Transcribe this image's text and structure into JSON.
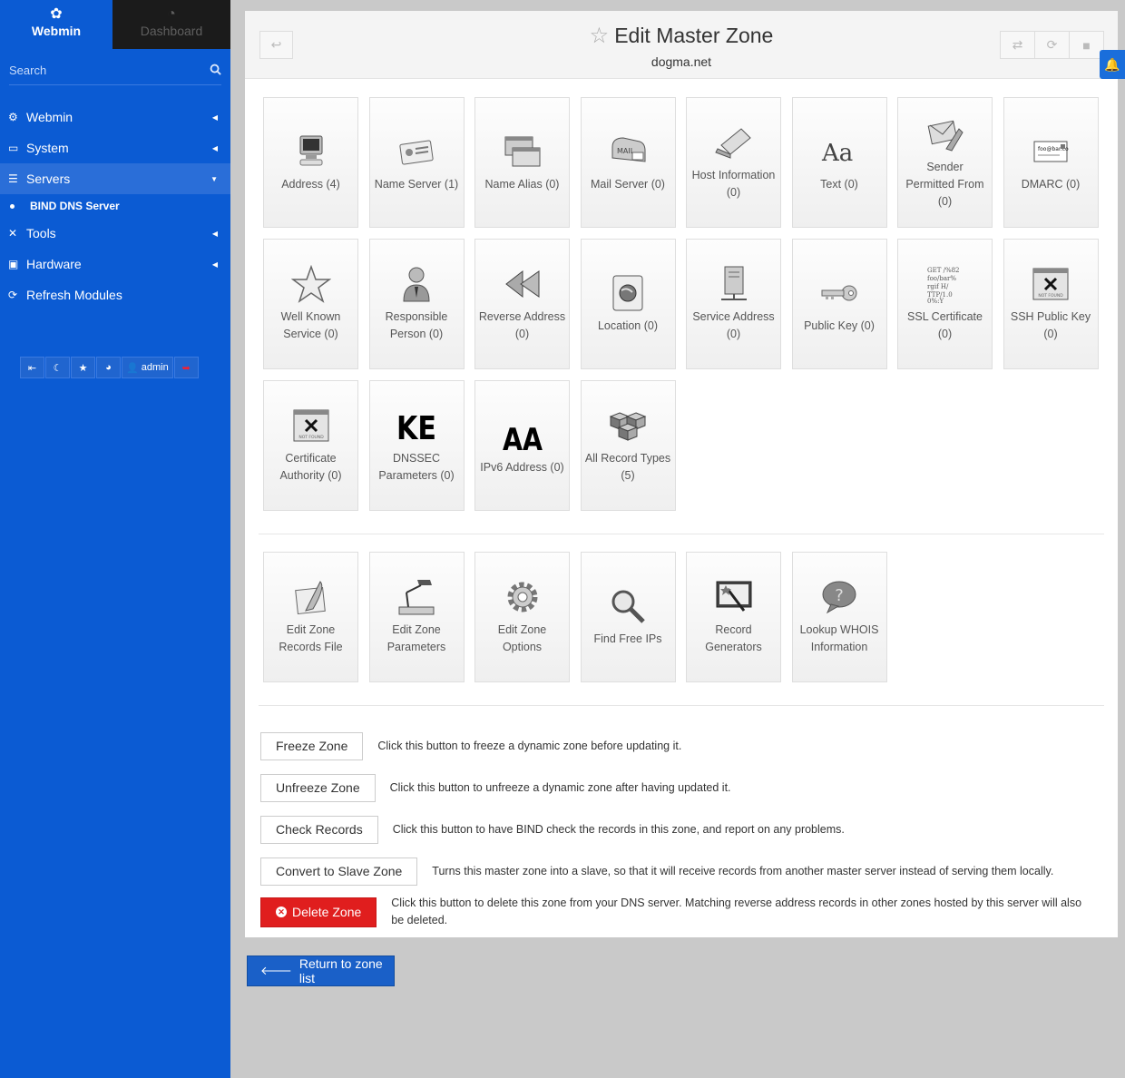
{
  "sidebar": {
    "tabs": {
      "webmin": "Webmin",
      "dashboard": "Dashboard"
    },
    "search_placeholder": "Search",
    "menu": {
      "webmin": "Webmin",
      "system": "System",
      "servers": "Servers",
      "bind": "BIND DNS Server",
      "tools": "Tools",
      "hardware": "Hardware",
      "refresh": "Refresh Modules"
    },
    "user": "admin"
  },
  "header": {
    "title": "Edit Master Zone",
    "zone": "dogma.net"
  },
  "record_tiles": [
    {
      "label": "Address (4)",
      "icon": "computer-icon"
    },
    {
      "label": "Name Server (1)",
      "icon": "id-card-icon"
    },
    {
      "label": "Name Alias (0)",
      "icon": "windows-icon"
    },
    {
      "label": "Mail Server (0)",
      "icon": "mailbox-icon"
    },
    {
      "label": "Host Information (0)",
      "icon": "laptop-icon"
    },
    {
      "label": "Text (0)",
      "icon": "font-icon"
    },
    {
      "label": "Sender Permitted From (0)",
      "icon": "mail-wrench-icon"
    },
    {
      "label": "DMARC (0)",
      "icon": "email-card-icon"
    },
    {
      "label": "Well Known Service (0)",
      "icon": "star-icon"
    },
    {
      "label": "Responsible Person (0)",
      "icon": "person-icon"
    },
    {
      "label": "Reverse Address (0)",
      "icon": "rewind-icon"
    },
    {
      "label": "Location (0)",
      "icon": "globe-icon"
    },
    {
      "label": "Service Address (0)",
      "icon": "server-icon"
    },
    {
      "label": "Public Key (0)",
      "icon": "key-icon"
    },
    {
      "label": "SSL Certificate (0)",
      "icon": "certificate-text-icon"
    },
    {
      "label": "SSH Public Key (0)",
      "icon": "not-found-icon"
    },
    {
      "label": "Certificate Authority (0)",
      "icon": "not-found-icon"
    },
    {
      "label": "DNSSEC Parameters (0)",
      "icon": "ke-text-icon"
    },
    {
      "label": "IPv6 Address (0)",
      "icon": "aa-text-icon"
    },
    {
      "label": "All Record Types (5)",
      "icon": "cubes-icon"
    }
  ],
  "tool_tiles": [
    {
      "label": "Edit Zone Records File",
      "icon": "quill-icon"
    },
    {
      "label": "Edit Zone Parameters",
      "icon": "desk-lamp-icon"
    },
    {
      "label": "Edit Zone Options",
      "icon": "gear-icon"
    },
    {
      "label": "Find Free IPs",
      "icon": "magnifier-icon"
    },
    {
      "label": "Record Generators",
      "icon": "wand-icon"
    },
    {
      "label": "Lookup WHOIS Information",
      "icon": "question-bubble-icon"
    }
  ],
  "ssh_icon_text": "NOT FOUND",
  "actions": {
    "freeze": {
      "label": "Freeze Zone",
      "desc": "Click this button to freeze a dynamic zone before updating it."
    },
    "unfreeze": {
      "label": "Unfreeze Zone",
      "desc": "Click this button to unfreeze a dynamic zone after having updated it."
    },
    "check": {
      "label": "Check Records",
      "desc": "Click this button to have BIND check the records in this zone, and report on any problems."
    },
    "convert": {
      "label": "Convert to Slave Zone",
      "desc": "Turns this master zone into a slave, so that it will receive records from another master server instead of serving them locally."
    },
    "delete": {
      "label": "Delete Zone",
      "desc": "Click this button to delete this zone from your DNS server. Matching reverse address records in other zones hosted by this server will also be deleted."
    }
  },
  "return_label": "Return to zone list",
  "colors": {
    "sidebar": "#0b5bd3",
    "danger": "#e01e1e",
    "primary": "#1a60c8"
  }
}
